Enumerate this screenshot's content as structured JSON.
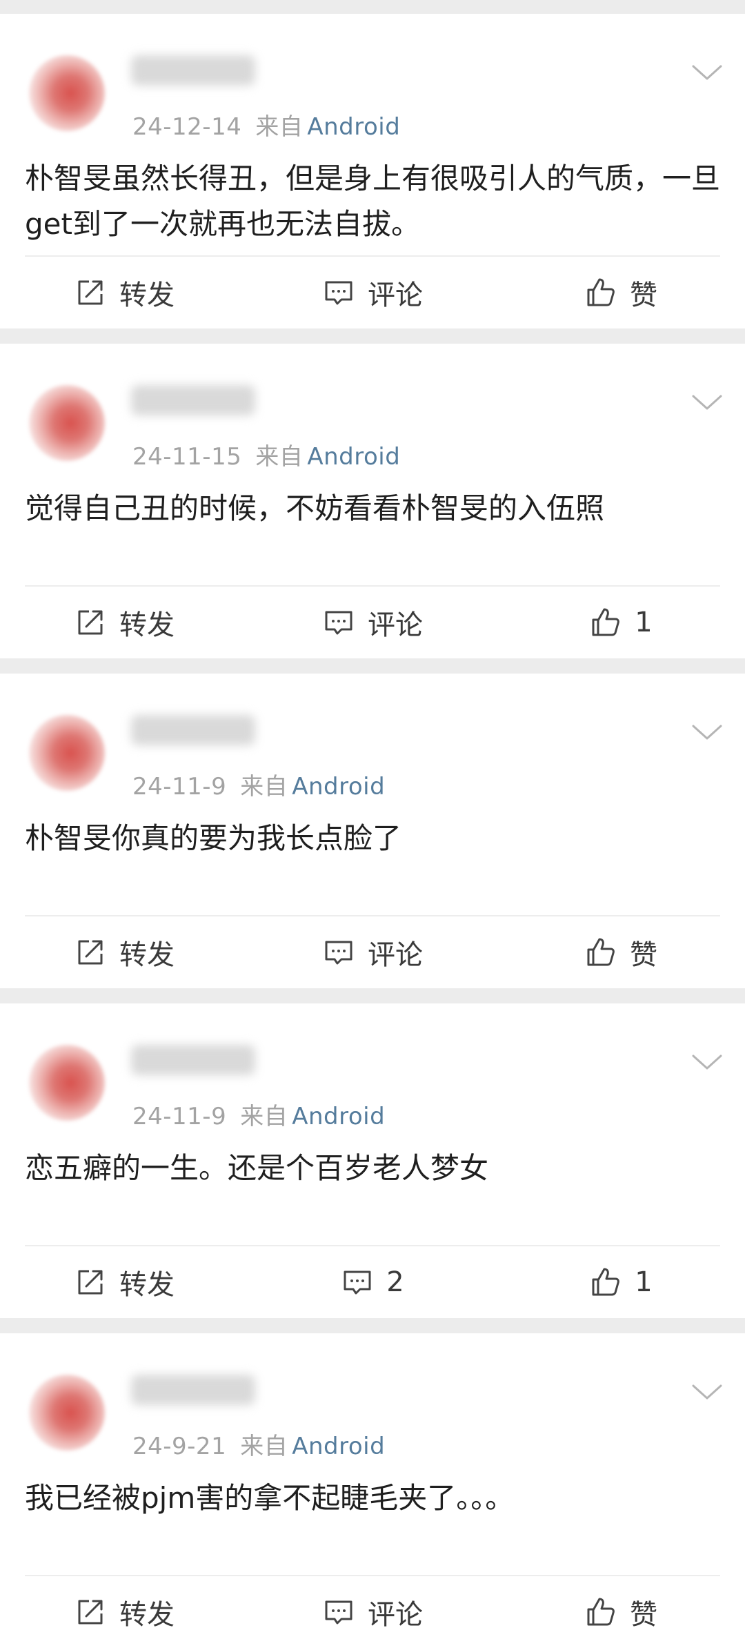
{
  "comments": [
    {
      "date": "24-12-14",
      "via": "来自",
      "source": "Android",
      "text": "朴智旻虽然长得丑，但是身上有很吸引人的气质，一旦get到了一次就再也无法自拔。",
      "repost": "转发",
      "comment": "评论",
      "like": "赞"
    },
    {
      "date": "24-11-15",
      "via": "来自",
      "source": "Android",
      "text": "觉得自己丑的时候，不妨看看朴智旻的入伍照",
      "repost": "转发",
      "comment": "评论",
      "like": "1"
    },
    {
      "date": "24-11-9",
      "via": "来自",
      "source": "Android",
      "text": "朴智旻你真的要为我长点脸了",
      "repost": "转发",
      "comment": "评论",
      "like": "赞"
    },
    {
      "date": "24-11-9",
      "via": "来自",
      "source": "Android",
      "text": "恋五癖的一生。还是个百岁老人梦女",
      "repost": "转发",
      "comment": "2",
      "like": "1"
    },
    {
      "date": "24-9-21",
      "via": "来自",
      "source": "Android",
      "text": "我已经被pjm害的拿不起睫毛夹了。。。",
      "repost": "转发",
      "comment": "评论",
      "like": "赞"
    }
  ]
}
